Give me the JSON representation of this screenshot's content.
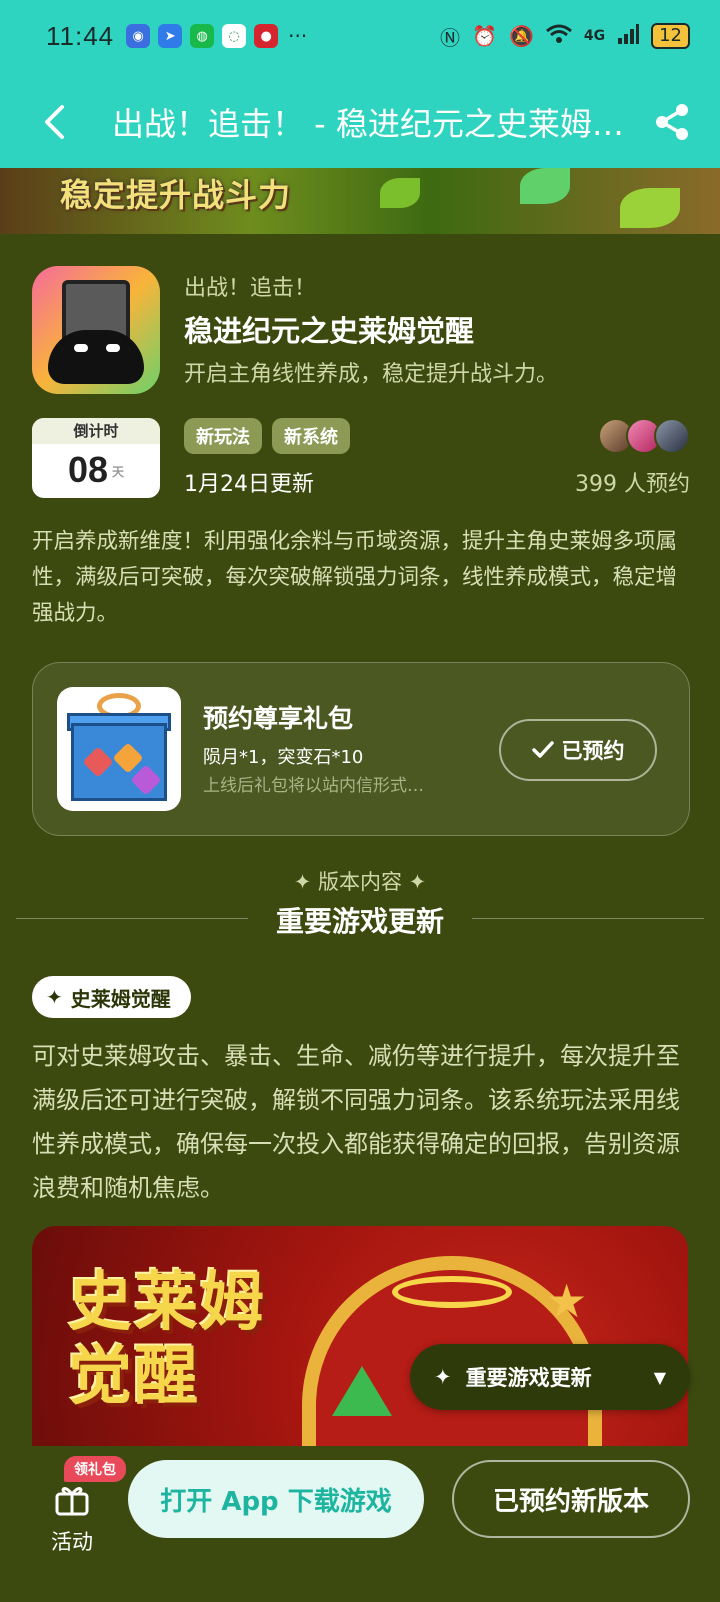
{
  "status_bar": {
    "time": "11:44",
    "dots": "···",
    "network": "4G",
    "battery": "12"
  },
  "header": {
    "title": "出战！追击！ - 稳进纪元之史莱姆觉醒",
    "back_icon": "back-arrow-icon",
    "share_icon": "share-icon"
  },
  "banner": {
    "text": "稳定提升战斗力"
  },
  "app": {
    "subtitle": "出战！追击！",
    "title": "稳进纪元之史莱姆觉醒",
    "description": "开启主角线性养成，稳定提升战斗力。"
  },
  "countdown": {
    "label": "倒计时",
    "value": "08",
    "unit": "天"
  },
  "tags": [
    "新玩法",
    "新系统"
  ],
  "update_date": "1月24日更新",
  "reserve_count": "399 人预约",
  "long_description": "开启养成新维度！利用强化余料与币域资源，提升主角史莱姆多项属性，满级后可突破，每次突破解锁强力词条，线性养成模式，稳定增强战力。",
  "gift": {
    "title": "预约尊享礼包",
    "items": "陨月*1，突变石*10",
    "note": "上线后礼包将以站内信形式…",
    "button": "已预约"
  },
  "section": {
    "label": "✦ 版本内容 ✦",
    "title": "重要游戏更新"
  },
  "feature": {
    "pill": "史莱姆觉醒",
    "text": "可对史莱姆攻击、暴击、生命、减伤等进行提升，每次提升至满级后还可进行突破，解锁不同强力词条。该系统玩法采用线性养成模式，确保每一次投入都能获得确定的回报，告别资源浪费和随机焦虑。"
  },
  "promo": {
    "text_line1": "史莱姆",
    "text_line2": "觉醒"
  },
  "float_tab": {
    "label": "重要游戏更新"
  },
  "bottom": {
    "activity_label": "活动",
    "badge": "领礼包",
    "open_button": "打开 App 下载游戏",
    "new_version_button": "已预约新版本"
  },
  "colors": {
    "header_bg": "#2fd4c0",
    "page_bg": "#3d4a0f",
    "tag_bg": "#8c9a55",
    "open_btn_text": "#1db5a0",
    "badge_bg": "#e84a5a"
  }
}
